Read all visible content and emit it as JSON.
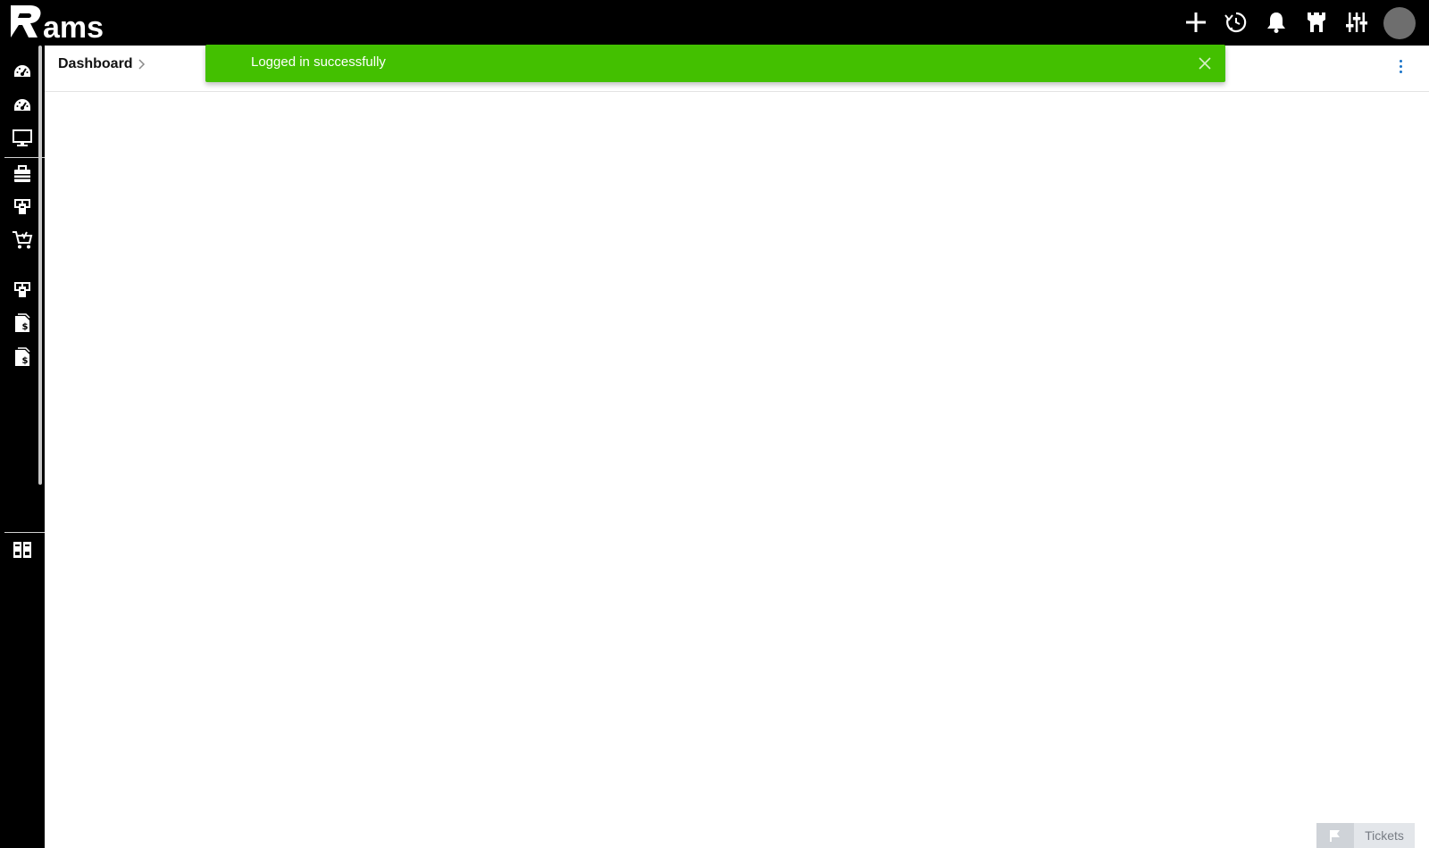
{
  "app": {
    "logo_text": "Rams"
  },
  "header": {
    "breadcrumb": "Dashboard"
  },
  "toast": {
    "message": "Logged in successfully",
    "color": "#43c000"
  },
  "top_actions": [
    {
      "icon": "plus-icon"
    },
    {
      "icon": "history-icon"
    },
    {
      "icon": "bell-icon"
    },
    {
      "icon": "castle-icon"
    },
    {
      "icon": "sliders-icon"
    },
    {
      "icon": "avatar"
    }
  ],
  "sidebar": {
    "items": [
      {
        "icon": "dashboard-gauge-icon"
      },
      {
        "icon": "dashboard-gauge-icon"
      },
      {
        "icon": "monitor-icon"
      },
      {
        "icon": "briefcase-icon"
      },
      {
        "icon": "assets-icon"
      },
      {
        "icon": "cart-icon"
      },
      {
        "icon": "assets-icon"
      },
      {
        "icon": "invoice-dollar-icon"
      },
      {
        "icon": "invoice-dollar-icon"
      },
      {
        "icon": "layout-grid-icon"
      }
    ]
  },
  "tickets": {
    "label": "Tickets"
  }
}
